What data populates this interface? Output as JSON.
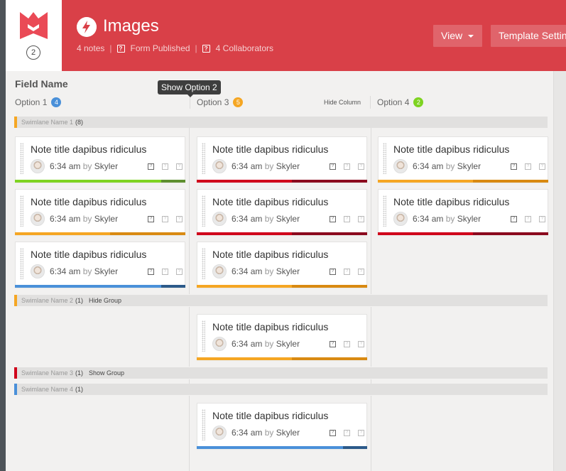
{
  "header": {
    "logo_badge": "2",
    "title": "Images",
    "notes": "4 notes",
    "form_status": "Form Published",
    "collaborators": "4 Collaborators",
    "separator": "|",
    "view_label": "View",
    "template_label": "Template Settings",
    "icons": [
      "logo-icon",
      "lightning-bolt-icon",
      "help-box-icon",
      "caret-down-icon"
    ]
  },
  "board": {
    "field_label": "Field Name",
    "tooltip": "Show Option 2",
    "hide_column_label": "Hide Column",
    "columns": [
      {
        "label": "Option 1",
        "count": "4",
        "color": "#4a90d9"
      },
      {
        "label": "Option 3",
        "count": "5",
        "color": "#f5a623"
      },
      {
        "label": "Option 4",
        "count": "2",
        "color": "#7ed321"
      }
    ]
  },
  "swimlanes": [
    {
      "name": "Swimlane Name 1",
      "count": "(8)",
      "action": "",
      "color": "#f5a623"
    },
    {
      "name": "Swimlane Name 2",
      "count": "(1)",
      "action": "Hide Group",
      "color": "#f5a623"
    },
    {
      "name": "Swimlane Name 3",
      "count": "(1)",
      "action": "Show Group",
      "color": "#d0021b"
    },
    {
      "name": "Swimlane Name 4",
      "count": "(1)",
      "action": "",
      "color": "#4a90d9"
    }
  ],
  "card": {
    "title": "Note title dapibus ridiculus",
    "time": "6:34 am",
    "by": "by",
    "author": "Skyler",
    "help_glyph": "?"
  },
  "status_colors": {
    "green": [
      "#7ed321",
      "#5e8f2f"
    ],
    "red": [
      "#d0021b",
      "#8b0a1e"
    ],
    "orange": [
      "#f5a623",
      "#d98a12"
    ],
    "blue": [
      "#4a90d9",
      "#2c5a8a"
    ]
  }
}
